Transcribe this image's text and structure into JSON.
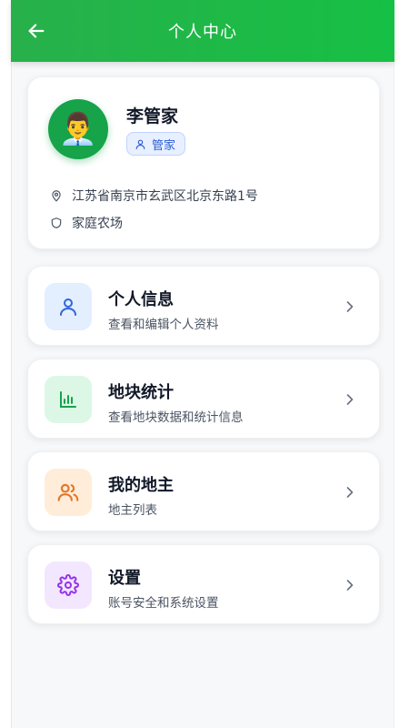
{
  "header": {
    "title": "个人中心"
  },
  "profile": {
    "name": "李管家",
    "avatar_emoji": "👨‍💼",
    "role": "管家",
    "address": "江苏省南京市玄武区北京东路1号",
    "farm": "家庭农场"
  },
  "menu": [
    {
      "title": "个人信息",
      "subtitle": "查看和编辑个人资料",
      "icon": "user-icon",
      "bg": "#e3eeff",
      "color": "#2f66d8"
    },
    {
      "title": "地块统计",
      "subtitle": "查看地块数据和统计信息",
      "icon": "bar-chart-icon",
      "bg": "#dcf7e6",
      "color": "#16a34a"
    },
    {
      "title": "我的地主",
      "subtitle": "地主列表",
      "icon": "users-icon",
      "bg": "#ffedd9",
      "color": "#e5762a"
    },
    {
      "title": "设置",
      "subtitle": "账号安全和系统设置",
      "icon": "gear-icon",
      "bg": "#f3e6ff",
      "color": "#9333ea"
    }
  ],
  "colors": {
    "header_green": "#1cb848",
    "accent_blue": "#2b5cd6"
  }
}
